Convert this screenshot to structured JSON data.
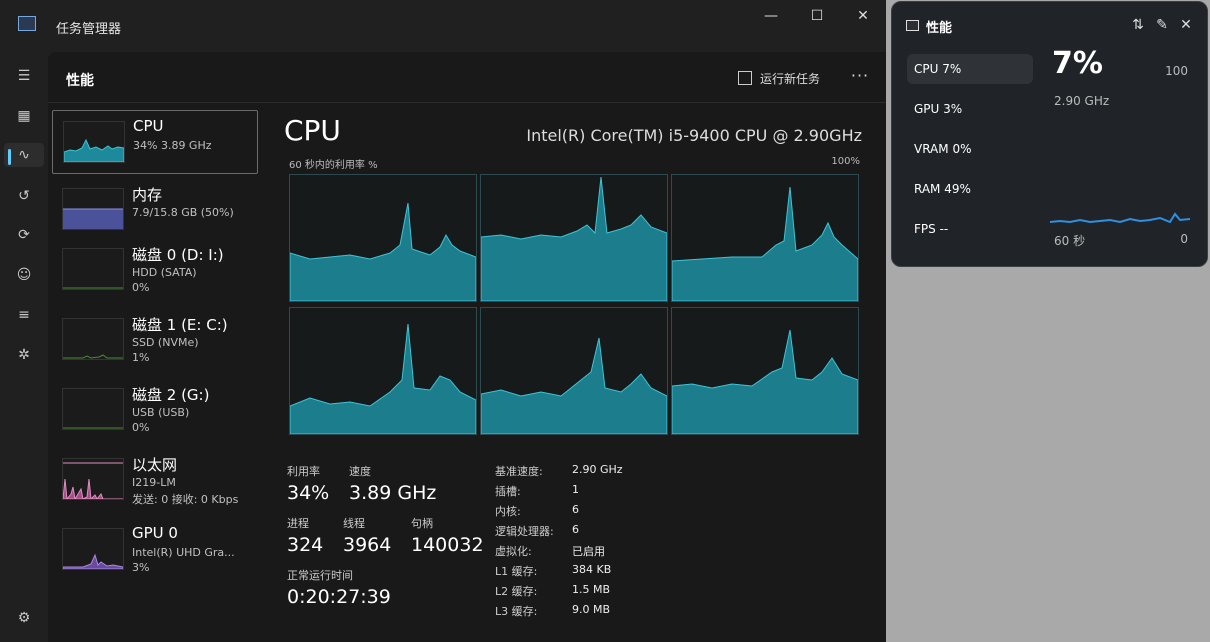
{
  "window": {
    "title": "任务管理器",
    "minimize": "—",
    "maximize": "☐",
    "close": "✕"
  },
  "header": {
    "title": "性能",
    "new_task": "运行新任务",
    "more": "···"
  },
  "sidebar_items": [
    {
      "name": "CPU",
      "sub": "34% 3.89 GHz",
      "sub2": ""
    },
    {
      "name": "内存",
      "sub": "7.9/15.8 GB (50%)",
      "sub2": ""
    },
    {
      "name": "磁盘 0 (D: I:)",
      "sub": "HDD (SATA)",
      "sub2": "0%"
    },
    {
      "name": "磁盘 1 (E: C:)",
      "sub": "SSD (NVMe)",
      "sub2": "1%"
    },
    {
      "name": "磁盘 2 (G:)",
      "sub": "USB (USB)",
      "sub2": "0%"
    },
    {
      "name": "以太网",
      "sub": "I219-LM",
      "sub2": "发送: 0 接收: 0 Kbps"
    },
    {
      "name": "GPU 0",
      "sub": "Intel(R) UHD Gra...",
      "sub2": "3%"
    }
  ],
  "main": {
    "title": "CPU",
    "model": "Intel(R) Core(TM) i5-9400 CPU @ 2.90GHz",
    "graph_label": "60 秒内的利用率 %",
    "graph_max": "100%"
  },
  "stats": {
    "util_label": "利用率",
    "util_value": "34%",
    "speed_label": "速度",
    "speed_value": "3.89 GHz",
    "proc_label": "进程",
    "proc_value": "324",
    "thread_label": "线程",
    "thread_value": "3964",
    "handle_label": "句柄",
    "handle_value": "140032",
    "uptime_label": "正常运行时间",
    "uptime_value": "0:20:27:39"
  },
  "specs": [
    {
      "k": "基准速度:",
      "v": "2.90 GHz"
    },
    {
      "k": "插槽:",
      "v": "1"
    },
    {
      "k": "内核:",
      "v": "6"
    },
    {
      "k": "逻辑处理器:",
      "v": "6"
    },
    {
      "k": "虚拟化:",
      "v": "已启用"
    },
    {
      "k": "L1 缓存:",
      "v": "384 KB"
    },
    {
      "k": "L2 缓存:",
      "v": "1.5 MB"
    },
    {
      "k": "L3 缓存:",
      "v": "9.0 MB"
    }
  ],
  "overlay": {
    "title": "性能",
    "items": [
      "CPU   7%",
      "GPU   3%",
      "VRAM   0%",
      "RAM   49%",
      "FPS --"
    ],
    "big": "7%",
    "max": "100",
    "speed": "2.90 GHz",
    "axis_left": "60 秒",
    "axis_right": "0"
  },
  "colors": {
    "cpu": "#1c8a9a",
    "memory": "#5b62b8",
    "ethernet": "#c86fa5",
    "gpu": "#7b55b0",
    "accent": "#60cdff"
  }
}
